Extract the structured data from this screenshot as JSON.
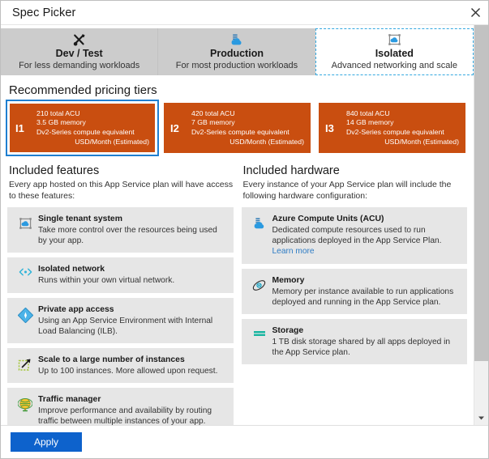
{
  "window": {
    "title": "Spec Picker",
    "close_icon": "close-icon"
  },
  "tabs": [
    {
      "label": "Dev / Test",
      "sub": "For less demanding workloads",
      "icon": "tools-icon",
      "selected": false
    },
    {
      "label": "Production",
      "sub": "For most production workloads",
      "icon": "database-cloud-icon",
      "selected": false
    },
    {
      "label": "Isolated",
      "sub": "Advanced networking and scale",
      "icon": "isolated-cloud-icon",
      "selected": true
    }
  ],
  "pricing": {
    "heading": "Recommended pricing tiers",
    "tiers": [
      {
        "code": "I1",
        "acu": "210 total ACU",
        "memory": "3.5 GB memory",
        "compute": "Dv2-Series compute equivalent",
        "price": "USD/Month (Estimated)",
        "selected": true
      },
      {
        "code": "I2",
        "acu": "420 total ACU",
        "memory": "7 GB memory",
        "compute": "Dv2-Series compute equivalent",
        "price": "USD/Month (Estimated)",
        "selected": false
      },
      {
        "code": "I3",
        "acu": "840 total ACU",
        "memory": "14 GB memory",
        "compute": "Dv2-Series compute equivalent",
        "price": "USD/Month (Estimated)",
        "selected": false
      }
    ]
  },
  "features": {
    "title": "Included features",
    "subtitle": "Every app hosted on this App Service plan will have access to these features:",
    "items": [
      {
        "icon": "single-tenant-icon",
        "title": "Single tenant system",
        "desc": "Take more control over the resources being used by your app."
      },
      {
        "icon": "isolated-network-icon",
        "title": "Isolated network",
        "desc": "Runs within your own virtual network."
      },
      {
        "icon": "private-access-icon",
        "title": "Private app access",
        "desc": "Using an App Service Environment with Internal Load Balancing (ILB)."
      },
      {
        "icon": "scale-out-icon",
        "title": "Scale to a large number of instances",
        "desc": "Up to 100 instances. More allowed upon request."
      },
      {
        "icon": "traffic-manager-icon",
        "title": "Traffic manager",
        "desc": "Improve performance and availability by routing traffic between multiple instances of your app."
      }
    ]
  },
  "hardware": {
    "title": "Included hardware",
    "subtitle": "Every instance of your App Service plan will include the following hardware configuration:",
    "items": [
      {
        "icon": "compute-units-icon",
        "title": "Azure Compute Units (ACU)",
        "desc": "Dedicated compute resources used to run applications deployed in the App Service Plan.",
        "link": "Learn more"
      },
      {
        "icon": "memory-icon",
        "title": "Memory",
        "desc": "Memory per instance available to run applications deployed and running in the App Service plan.",
        "link": ""
      },
      {
        "icon": "storage-icon",
        "title": "Storage",
        "desc": "1 TB disk storage shared by all apps deployed in the App Service plan.",
        "link": ""
      }
    ]
  },
  "footer": {
    "apply_label": "Apply"
  },
  "colors": {
    "tier_card": "#c94e10",
    "selection_blue": "#1f7fd0",
    "accent_dashed": "#34a8e0",
    "apply_blue": "#0d62cc",
    "link_blue": "#2e7cc4"
  }
}
